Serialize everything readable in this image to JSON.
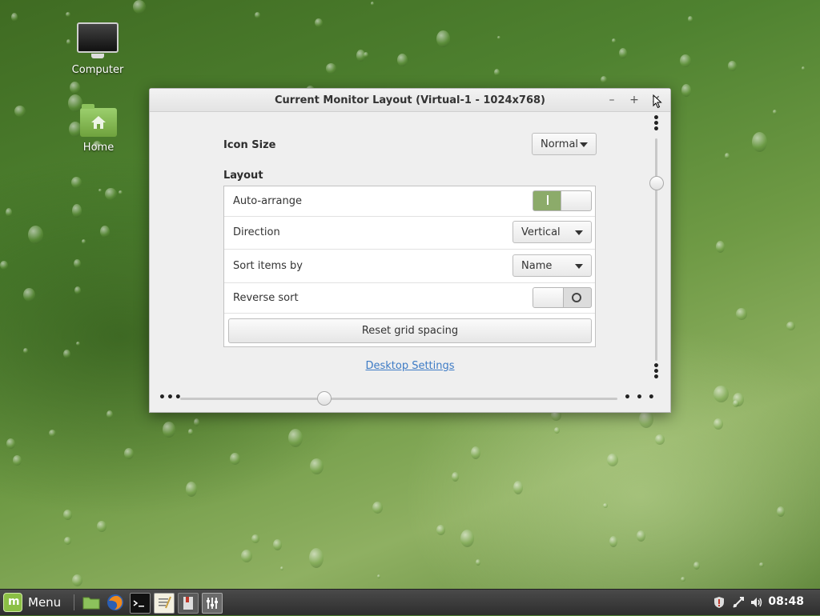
{
  "desktop": {
    "icons": [
      {
        "label": "Computer",
        "icon": "computer-icon"
      },
      {
        "label": "Home",
        "icon": "home-folder-icon"
      }
    ]
  },
  "window": {
    "title": "Current Monitor Layout (Virtual-1 - 1024x768)",
    "minimize": "–",
    "maximize": "+",
    "close": "✕",
    "icon_size": {
      "label": "Icon Size",
      "value": "Normal"
    },
    "layout_label": "Layout",
    "rows": {
      "auto_arrange": {
        "label": "Auto-arrange",
        "state": "on"
      },
      "direction": {
        "label": "Direction",
        "value": "Vertical"
      },
      "sort_items_by": {
        "label": "Sort items by",
        "value": "Name"
      },
      "reverse_sort": {
        "label": "Reverse sort",
        "state": "off"
      }
    },
    "reset_button": "Reset grid spacing",
    "link": "Desktop Settings"
  },
  "taskbar": {
    "menu_label": "Menu",
    "clock": "08:48",
    "launchers": [
      "folder-icon",
      "firefox-icon",
      "terminal-icon",
      "text-editor-icon",
      "document-viewer-icon",
      "settings-icon"
    ],
    "tray": [
      "shield-icon",
      "network-icon",
      "volume-icon"
    ]
  },
  "colors": {
    "toggle_on": "#8cab6a",
    "link": "#3d7bc5",
    "mint_green": "#8bbf45"
  }
}
